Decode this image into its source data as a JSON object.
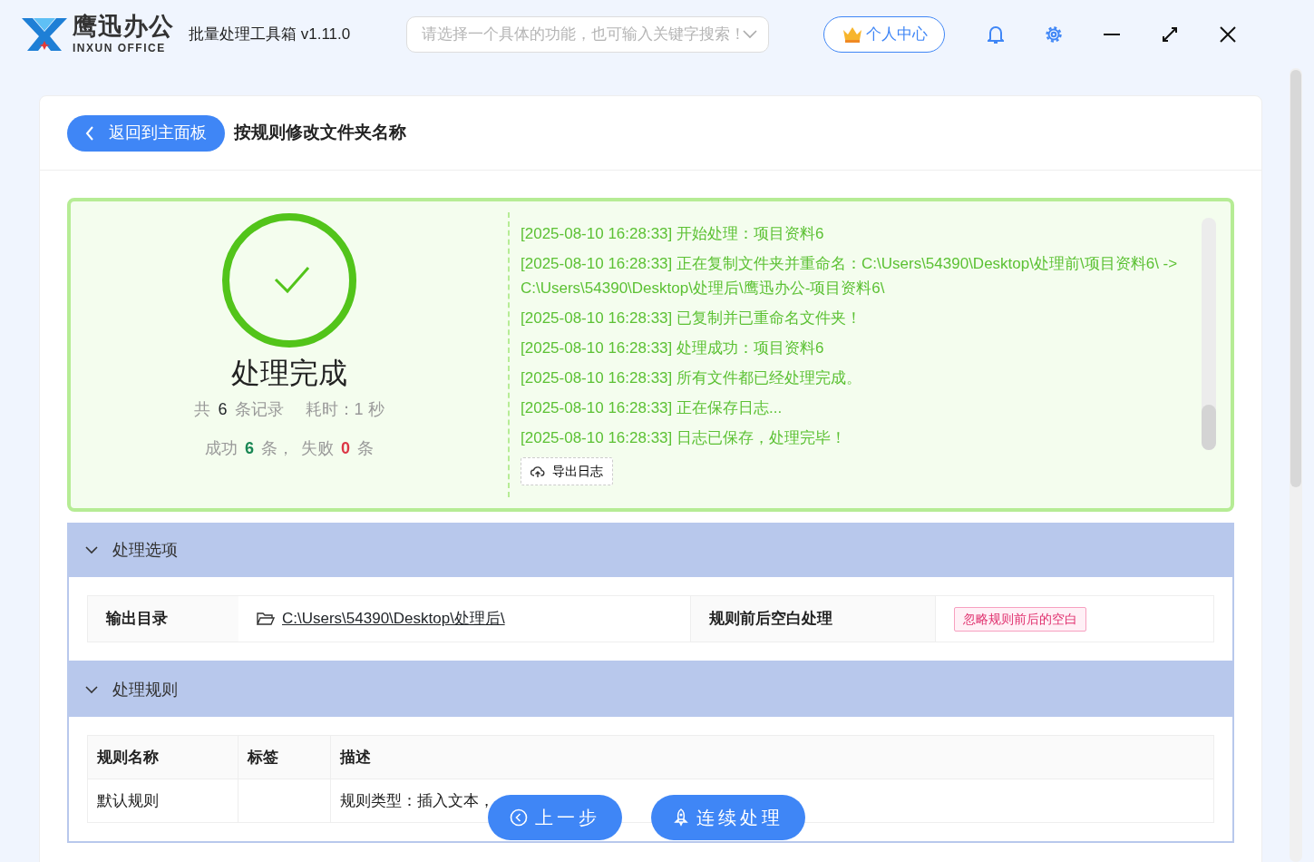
{
  "app": {
    "brand_cn": "鹰迅办公",
    "brand_en": "INXUN OFFICE",
    "title": "批量处理工具箱 v1.11.0"
  },
  "search": {
    "placeholder": "请选择一个具体的功能，也可输入关键字搜索！"
  },
  "user_button": "个人中心",
  "page": {
    "back_button": "返回到主面板",
    "title": "按规则修改文件夹名称"
  },
  "result": {
    "status": "处理完成",
    "total_prefix": "共",
    "total": "6",
    "total_suffix": "条记录",
    "time": "耗时：1 秒",
    "success_label": "成功",
    "success": "6",
    "success_unit": "条，",
    "fail_label": "失败",
    "fail": "0",
    "fail_unit": "条"
  },
  "log": [
    "[2025-08-10 16:28:33] 开始处理：项目资料6",
    "[2025-08-10 16:28:33] 正在复制文件夹并重命名：C:\\Users\\54390\\Desktop\\处理前\\项目资料6\\ -> C:\\Users\\54390\\Desktop\\处理后\\鹰迅办公-项目资料6\\",
    "[2025-08-10 16:28:33] 已复制并已重命名文件夹！",
    "[2025-08-10 16:28:33] 处理成功：项目资料6",
    "[2025-08-10 16:28:33] 所有文件都已经处理完成。",
    "[2025-08-10 16:28:33] 正在保存日志...",
    "[2025-08-10 16:28:33] 日志已保存，处理完毕！"
  ],
  "export_button": "导出日志",
  "options": {
    "title": "处理选项",
    "expanded": true,
    "output_label": "输出目录",
    "output_path": "C:\\Users\\54390\\Desktop\\处理后\\",
    "trim_label": "规则前后空白处理",
    "trim_tag": "忽略规则前后的空白"
  },
  "rules": {
    "title": "处理规则",
    "expanded": true,
    "columns": [
      "规则名称",
      "标签",
      "描述"
    ],
    "rows": [
      {
        "name": "默认规则",
        "description": "规则类型：插入文本，"
      }
    ]
  },
  "footer_buttons": [
    {
      "kind": "back",
      "label": "上一步"
    },
    {
      "kind": "run",
      "label": "连续处理"
    }
  ]
}
